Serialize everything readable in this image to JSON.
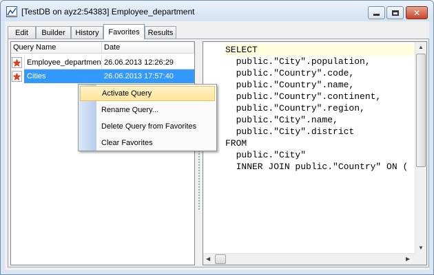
{
  "window": {
    "title": "[TestDB on ayz2:54383] Employee_department"
  },
  "tabs": [
    {
      "label": "Edit"
    },
    {
      "label": "Builder"
    },
    {
      "label": "History"
    },
    {
      "label": "Favorites"
    },
    {
      "label": "Results"
    }
  ],
  "favorites": {
    "columns": {
      "name": "Query Name",
      "date": "Date"
    },
    "rows": [
      {
        "name": "Employee_department",
        "date": "26.06.2013 12:26:29"
      },
      {
        "name": "Cities",
        "date": "26.06.2013 17:57:40"
      }
    ]
  },
  "context_menu": {
    "items": [
      {
        "label": "Activate Query"
      },
      {
        "label": "Rename Query..."
      },
      {
        "label": "Delete Query from Favorites"
      },
      {
        "label": "Clear Favorites"
      }
    ]
  },
  "editor": {
    "lines": [
      "SELECT",
      "  public.\"City\".population,",
      "  public.\"Country\".code,",
      "  public.\"Country\".name,",
      "  public.\"Country\".continent,",
      "  public.\"Country\".region,",
      "  public.\"City\".name,",
      "  public.\"City\".district",
      "FROM",
      "  public.\"City\"",
      "  INNER JOIN public.\"Country\" ON ("
    ]
  },
  "colors": {
    "selection": "#3399ff",
    "menu_highlight": "#ffe49a",
    "current_line": "#ffffdd"
  }
}
